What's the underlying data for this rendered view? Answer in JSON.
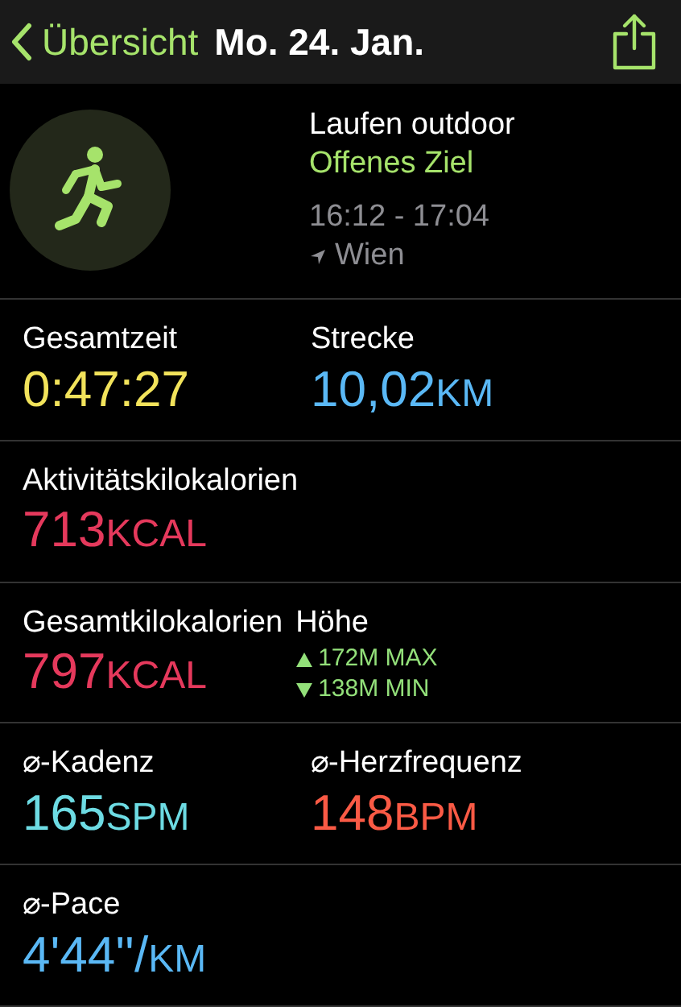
{
  "nav": {
    "back": "Übersicht",
    "title": "Mo. 24. Jan."
  },
  "workout": {
    "name": "Laufen outdoor",
    "goal": "Offenes Ziel",
    "time": "16:12 - 17:04",
    "location": "Wien"
  },
  "rows": [
    {
      "cells": [
        {
          "kind": "metric",
          "label": "Gesamtzeit",
          "value": "0:47:27",
          "color": "#f2e35b"
        },
        {
          "kind": "metric",
          "label": "Strecke",
          "value": "10,02",
          "unit": "KM",
          "color": "#5ab8f5"
        }
      ]
    },
    {
      "cells": [
        {
          "kind": "metric",
          "label": "Aktivitätskilokalorien",
          "value": "713",
          "unit": "KCAL",
          "color": "#e5395c"
        }
      ]
    },
    {
      "cells": [
        {
          "kind": "metric",
          "label": "Gesamtkilokalorien",
          "value": "797",
          "unit": "KCAL",
          "color": "#e5395c"
        },
        {
          "kind": "elevation",
          "label": "Höhe",
          "max": "172M MAX",
          "min": "138M MIN",
          "color": "#93e07a"
        }
      ]
    },
    {
      "cells": [
        {
          "kind": "metric",
          "label": "⌀-Kadenz",
          "value": "165",
          "unit": "SPM",
          "color": "#6ddbe3"
        },
        {
          "kind": "metric",
          "label": "⌀-Herzfrequenz",
          "value": "148",
          "unit": "BPM",
          "color": "#fa5a45"
        }
      ]
    },
    {
      "cells": [
        {
          "kind": "metric",
          "label": "⌀-Pace",
          "value": "4'44''/",
          "unit": "KM",
          "color": "#5ab8f5"
        }
      ]
    }
  ]
}
